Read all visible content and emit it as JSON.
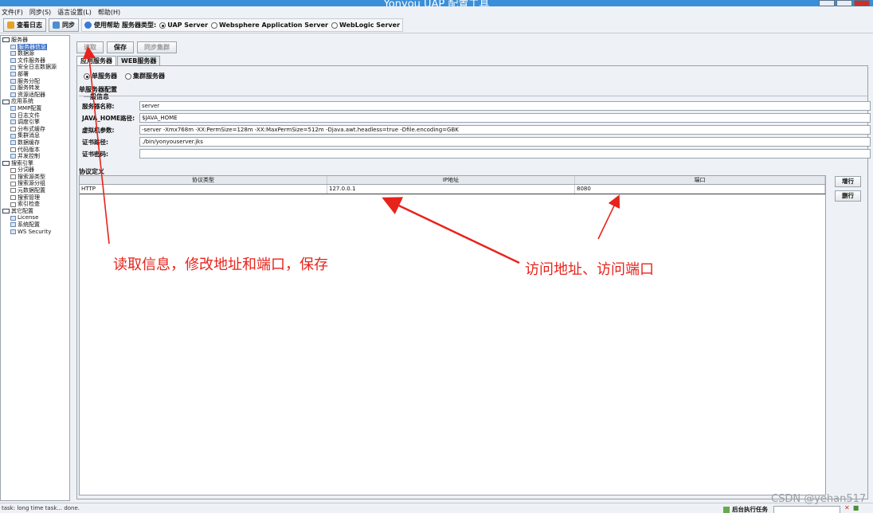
{
  "window": {
    "title": "Yonyou UAP 配置工具"
  },
  "menu": [
    "文件(F)",
    "同步(S)",
    "语言设置(L)",
    "帮助(H)"
  ],
  "toolbar": {
    "view_log": "查看日志",
    "sync": "同步",
    "use_help": "使用帮助",
    "server_type_label": "服务器类型:",
    "server_types": [
      "UAP Server",
      "Websphere Application Server",
      "WebLogic Server"
    ]
  },
  "sidebar": {
    "items": [
      {
        "label": "服务器",
        "level": 0,
        "icon": "folder-expanded-icon"
      },
      {
        "label": "服务器信息",
        "level": 1,
        "icon": "server-icon",
        "selected": true
      },
      {
        "label": "数据源",
        "level": 1,
        "icon": "datasource-icon"
      },
      {
        "label": "文件服务器",
        "level": 1,
        "icon": "file-server-icon"
      },
      {
        "label": "安全日志数据源",
        "level": 1,
        "icon": "datasource-icon"
      },
      {
        "label": "部署",
        "level": 1,
        "icon": "deploy-icon"
      },
      {
        "label": "服务分配",
        "level": 1,
        "icon": "service-icon"
      },
      {
        "label": "服务转发",
        "level": 1,
        "icon": "forward-icon"
      },
      {
        "label": "资源适配器",
        "level": 1,
        "icon": "adapter-icon"
      },
      {
        "label": "应用系统",
        "level": 0,
        "icon": "folder-expanded-icon"
      },
      {
        "label": "MMP配置",
        "level": 1,
        "icon": "config-icon"
      },
      {
        "label": "日志文件",
        "level": 1,
        "icon": "log-icon"
      },
      {
        "label": "调度引擎",
        "level": 1,
        "icon": "scheduler-icon"
      },
      {
        "label": "分布式缓存",
        "level": 1,
        "icon": "document-icon"
      },
      {
        "label": "集群消息",
        "level": 1,
        "icon": "message-icon"
      },
      {
        "label": "数据缓存",
        "level": 1,
        "icon": "cache-icon"
      },
      {
        "label": "代码版本",
        "level": 1,
        "icon": "document-icon"
      },
      {
        "label": "并发控制",
        "level": 1,
        "icon": "concurrency-icon"
      },
      {
        "label": "搜索引擎",
        "level": 0,
        "icon": "folder-expanded-icon"
      },
      {
        "label": "分词器",
        "level": 1,
        "icon": "document-icon"
      },
      {
        "label": "搜索源类型",
        "level": 1,
        "icon": "document-icon"
      },
      {
        "label": "搜索源分组",
        "level": 1,
        "icon": "document-icon"
      },
      {
        "label": "元数据配置",
        "level": 1,
        "icon": "document-icon"
      },
      {
        "label": "搜索管理",
        "level": 1,
        "icon": "document-icon"
      },
      {
        "label": "索引检查",
        "level": 1,
        "icon": "document-icon"
      },
      {
        "label": "其它配置",
        "level": 0,
        "icon": "folder-expanded-icon"
      },
      {
        "label": "License",
        "level": 1,
        "icon": "license-icon"
      },
      {
        "label": "系统配置",
        "level": 1,
        "icon": "system-icon"
      },
      {
        "label": "WS Security",
        "level": 1,
        "icon": "security-icon"
      }
    ]
  },
  "main": {
    "buttons": {
      "read": "读取",
      "save": "保存",
      "sync_cluster": "同步集群"
    },
    "tabs": [
      "应用服务器",
      "WEB服务器"
    ],
    "modes": [
      "单服务器",
      "集群服务器"
    ],
    "single_config_title": "单服务器配置",
    "general_info_title": "一般信息",
    "fields": [
      {
        "label": "服务器名称:",
        "value": "server"
      },
      {
        "label": "JAVA_HOME路径:",
        "value": "$JAVA_HOME"
      },
      {
        "label": "虚拟机参数:",
        "value": "-server -Xmx768m -XX:PermSize=128m -XX:MaxPermSize=512m -Djava.awt.headless=true -Dfile.encoding=GBK"
      },
      {
        "label": "证书路径:",
        "value": "./bin/yonyouserver.jks"
      },
      {
        "label": "证书密码:",
        "value": ""
      }
    ],
    "protocol_title": "协议定义",
    "table": {
      "headers": [
        "协议类型",
        "IP地址",
        "端口"
      ],
      "rows": [
        [
          "HTTP",
          "127.0.0.1",
          "8080"
        ]
      ]
    },
    "row_buttons": {
      "add": "增行",
      "delete": "删行"
    }
  },
  "annotations": {
    "left": "读取信息，修改地址和端口，保存",
    "right": "访问地址、访问端口",
    "color": "#e8231b"
  },
  "status": {
    "text": "task: long time task... done.",
    "bg_task_label": "后台执行任务"
  },
  "watermark": "CSDN @yehan517"
}
